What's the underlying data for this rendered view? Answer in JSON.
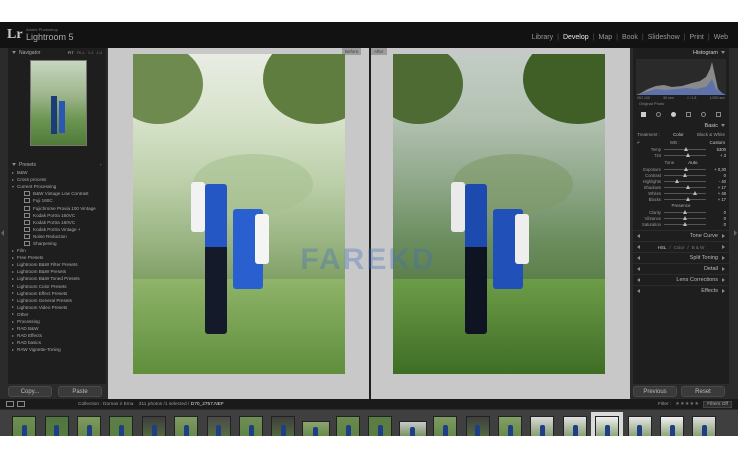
{
  "app": {
    "publisher": "Adobe Photoshop",
    "title": "Lightroom 5",
    "logo": "Lr"
  },
  "modules": [
    {
      "label": "Library",
      "active": false
    },
    {
      "label": "Develop",
      "active": true
    },
    {
      "label": "Map",
      "active": false
    },
    {
      "label": "Book",
      "active": false
    },
    {
      "label": "Slideshow",
      "active": false
    },
    {
      "label": "Print",
      "active": false
    },
    {
      "label": "Web",
      "active": false
    }
  ],
  "navigator": {
    "title": "Navigator",
    "options": [
      "FIT",
      "FILL",
      "1:1",
      "1:4"
    ]
  },
  "presets": {
    "title": "Presets",
    "items": [
      {
        "label": "B&W",
        "type": "folder"
      },
      {
        "label": "Cross process",
        "type": "folder"
      },
      {
        "label": "Current Processing",
        "type": "open"
      },
      {
        "label": "B&W Vintage Low Contrast",
        "type": "child"
      },
      {
        "label": "Fuji 160C",
        "type": "child"
      },
      {
        "label": "Fujichrome Provia 100 Vintage",
        "type": "child"
      },
      {
        "label": "Kodak Portra 160VC",
        "type": "child"
      },
      {
        "label": "Kodak Portra 160VC",
        "type": "child"
      },
      {
        "label": "Kodak Portra Vintage +",
        "type": "child"
      },
      {
        "label": "Noise Reduction",
        "type": "child"
      },
      {
        "label": "Sharpening",
        "type": "child"
      },
      {
        "label": "Film",
        "type": "folder"
      },
      {
        "label": "Free Presets",
        "type": "folder"
      },
      {
        "label": "Lightroom B&W Filter Presets",
        "type": "folder"
      },
      {
        "label": "Lightroom B&W Presets",
        "type": "folder"
      },
      {
        "label": "Lightroom B&W Toned Presets",
        "type": "folder"
      },
      {
        "label": "Lightroom Color Presets",
        "type": "folder"
      },
      {
        "label": "Lightroom Effect Presets",
        "type": "folder"
      },
      {
        "label": "Lightroom General Presets",
        "type": "folder"
      },
      {
        "label": "Lightroom Video Presets",
        "type": "folder"
      },
      {
        "label": "Other",
        "type": "folder"
      },
      {
        "label": "Processing",
        "type": "folder"
      },
      {
        "label": "RAD B&W",
        "type": "folder"
      },
      {
        "label": "RAD Effects",
        "type": "folder"
      },
      {
        "label": "RAD basics",
        "type": "folder"
      },
      {
        "label": "RAW Vignette-Toning",
        "type": "folder"
      }
    ]
  },
  "left_buttons": {
    "copy": "Copy...",
    "paste": "Paste"
  },
  "view": {
    "before_label": "Before",
    "after_label": "After",
    "watermark": "FAREKD"
  },
  "right": {
    "histogram_title": "Histogram",
    "hist_values": [
      "ISO 100",
      "50 mm",
      "f / 1.8",
      "1/250 sec"
    ],
    "original_photo": "Original Photo",
    "basic_title": "Basic",
    "treatment": {
      "label": "Treatment :",
      "color": "Color",
      "bw": "Black & White"
    },
    "wb": {
      "label": "WB :",
      "value": "Custom"
    },
    "temp": {
      "label": "Temp",
      "value": "5300"
    },
    "tint": {
      "label": "Tint",
      "value": "+ 3"
    },
    "tone": {
      "label": "Tone",
      "auto": "Auto"
    },
    "sliders": [
      {
        "label": "Exposure",
        "value": "+ 0,30",
        "pos": 0.52
      },
      {
        "label": "Contrast",
        "value": "0",
        "pos": 0.5
      },
      {
        "label": "Highlights",
        "value": "- 40",
        "pos": 0.3
      },
      {
        "label": "Shadows",
        "value": "+ 17",
        "pos": 0.58
      },
      {
        "label": "Whites",
        "value": "+ 48",
        "pos": 0.74
      },
      {
        "label": "Blacks",
        "value": "+ 17",
        "pos": 0.58
      }
    ],
    "presence": {
      "label": "Presence"
    },
    "presence_sliders": [
      {
        "label": "Clarity",
        "value": "0",
        "pos": 0.5
      },
      {
        "label": "Vibrance",
        "value": "0",
        "pos": 0.5
      },
      {
        "label": "Saturation",
        "value": "0",
        "pos": 0.5
      }
    ],
    "panels": [
      "Tone Curve",
      "Split Toning",
      "Detail",
      "Lens Corrections",
      "Effects"
    ],
    "hsl": {
      "label": "HSL",
      "sep1": "/",
      "color": "Color",
      "sep2": "/",
      "bw": "B & W"
    },
    "previous": "Previous",
    "reset": "Reset"
  },
  "filmstrip": {
    "collection": "Collection : Domas ir Ema",
    "count": "311 photos /1 selected /",
    "filename": "D70_2757.NEF",
    "filter_label": "Filter :",
    "filters_off": "Filters Off",
    "stars": "★★★★★"
  },
  "colors": {
    "accent_blue": "#1e3e86",
    "panel": "#1e1e1e",
    "bg": "#2b2b2b"
  }
}
